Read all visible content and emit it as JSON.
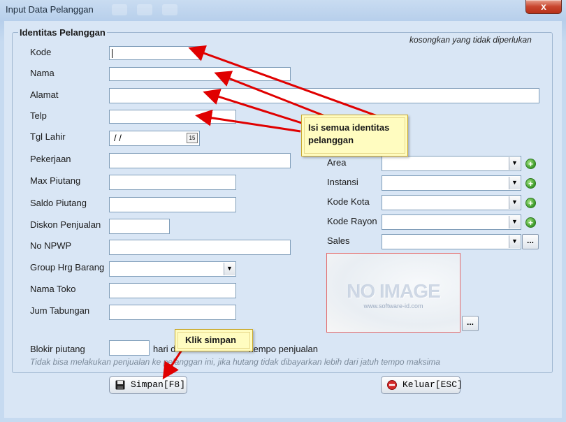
{
  "window": {
    "title": "Input Data Pelanggan",
    "close_label": "x"
  },
  "group": {
    "title": "Identitas Pelanggan",
    "hint": "kosongkan yang tidak diperlukan"
  },
  "labels": {
    "kode": "Kode",
    "nama": "Nama",
    "alamat": "Alamat",
    "telp": "Telp",
    "tgl_lahir": "Tgl Lahir",
    "pekerjaan": "Pekerjaan",
    "max_piutang": "Max Piutang",
    "saldo_piutang": "Saldo Piutang",
    "diskon_penjualan": "Diskon Penjualan",
    "no_npwp": "No NPWP",
    "group_hrg_barang": "Group Hrg Barang",
    "nama_toko": "Nama Toko",
    "jum_tabungan": "Jum Tabungan",
    "area": "Area",
    "instansi": "Instansi",
    "kode_kota": "Kode Kota",
    "kode_rayon": "Kode Rayon",
    "sales": "Sales",
    "blokir_piutang": "Blokir piutang",
    "blokir_suffix_a": "hari d",
    "blokir_suffix_b": "kempo penjualan"
  },
  "fields": {
    "tgl_lahir_value": " /  /",
    "calendar_glyph": "15"
  },
  "image": {
    "placeholder": "NO IMAGE",
    "source": "www.software-id.com"
  },
  "note": "Tidak bisa melakukan penjualan ke pelanggan ini, jika hutang tidak dibayarkan lebih dari jatuh tempo maksima",
  "buttons": {
    "simpan": "Simpan[F8]",
    "keluar": "Keluar[ESC]",
    "browse": "...",
    "combo_arrow": "▼",
    "add": "+"
  },
  "callouts": {
    "identitas_line1": "Isi semua identitas",
    "identitas_line2": "pelanggan",
    "simpan": "Klik simpan"
  },
  "colors": {
    "arrow": "#e00000",
    "callout_bg": "#fffcc0",
    "image_border": "#e46a6a"
  }
}
